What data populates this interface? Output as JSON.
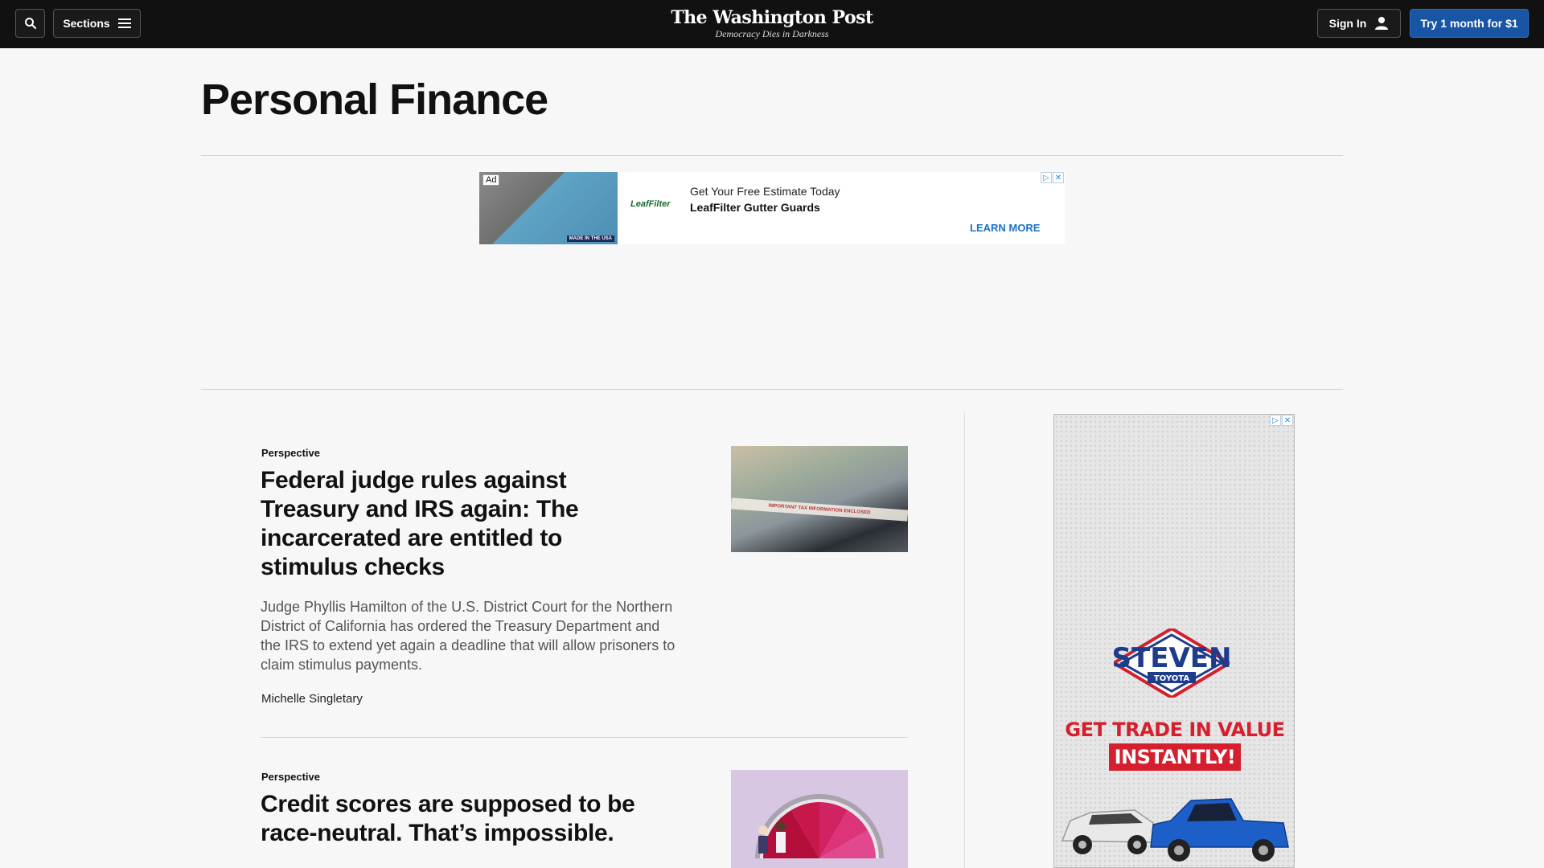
{
  "header": {
    "sections_label": "Sections",
    "logo_name": "The Washington Post",
    "logo_tagline": "Democracy Dies in Darkness",
    "signin_label": "Sign In",
    "trial_label": "Try 1 month for $1"
  },
  "page": {
    "title": "Personal Finance"
  },
  "top_ad": {
    "badge": "Ad",
    "made_in": "MADE IN THE USA",
    "brand": "LeafFilter",
    "headline": "Get Your Free Estimate Today",
    "subline": "LeafFilter Gutter Guards",
    "cta": "LEARN MORE"
  },
  "articles": [
    {
      "label": "Perspective",
      "headline": "Federal judge rules against Treasury and IRS again: The incarcerated are entitled to stimulus checks",
      "blurb": "Judge Phyllis Hamilton of the U.S. District Court for the Northern District of California has ordered the Treasury Department and the IRS to extend yet again a deadline that will allow prisoners to claim stimulus payments.",
      "byline": "Michelle Singletary",
      "image_text": "IMPORTANT TAX INFORMATION ENCLOSED"
    },
    {
      "label": "Perspective",
      "headline": "Credit scores are supposed to be race-neutral. That’s impossible."
    }
  ],
  "side_ad": {
    "brand": "STEVEN",
    "brand_sub": "TOYOTA",
    "promo_line1": "GET TRADE IN VALUE",
    "promo_line2": "INSTANTLY!"
  },
  "colors": {
    "header_bg": "#111111",
    "trial_button": "#1955a5",
    "ad_cta": "#1a73c9",
    "promo_red": "#d51f2e"
  }
}
